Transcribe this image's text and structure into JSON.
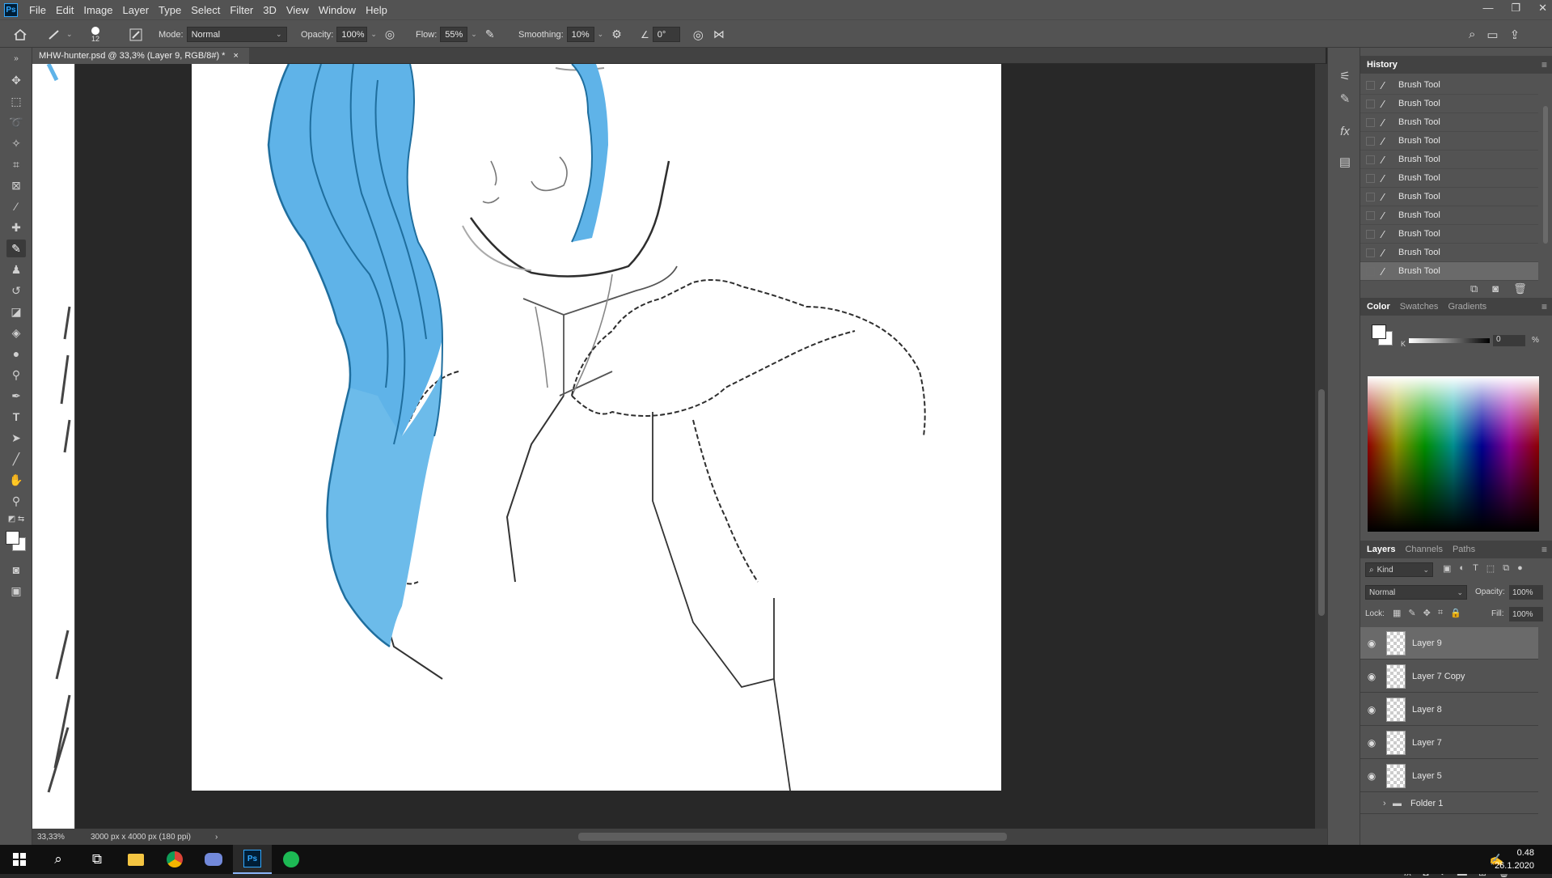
{
  "menubar": {
    "logo": "Ps",
    "items": [
      "File",
      "Edit",
      "Image",
      "Layer",
      "Type",
      "Select",
      "Filter",
      "3D",
      "View",
      "Window",
      "Help"
    ]
  },
  "options": {
    "brush_size": "12",
    "mode_label": "Mode:",
    "mode_value": "Normal",
    "opacity_label": "Opacity:",
    "opacity_value": "100%",
    "flow_label": "Flow:",
    "flow_value": "55%",
    "smoothing_label": "Smoothing:",
    "smoothing_value": "10%",
    "angle_value": "0°"
  },
  "document": {
    "tab_title": "MHW-hunter.psd @ 33,3% (Layer 9, RGB/8#) *",
    "close_glyph": "×"
  },
  "status": {
    "zoom": "33,33%",
    "doc_size": "3000 px x 4000 px (180 ppi)"
  },
  "history": {
    "title": "History",
    "items": [
      "Brush Tool",
      "Brush Tool",
      "Brush Tool",
      "Brush Tool",
      "Brush Tool",
      "Brush Tool",
      "Brush Tool",
      "Brush Tool",
      "Brush Tool",
      "Brush Tool",
      "Brush Tool"
    ]
  },
  "color_panel": {
    "tabs": [
      "Color",
      "Swatches",
      "Gradients"
    ],
    "k_label": "K",
    "k_value": "0",
    "k_unit": "%"
  },
  "layers_panel": {
    "tabs": [
      "Layers",
      "Channels",
      "Paths"
    ],
    "kind_label": "Kind",
    "blend_mode": "Normal",
    "opacity_label": "Opacity:",
    "opacity_value": "100%",
    "lock_label": "Lock:",
    "fill_label": "Fill:",
    "fill_value": "100%",
    "layers": [
      "Layer 9",
      "Layer 7 Copy",
      "Layer 8",
      "Layer 7",
      "Layer 5"
    ],
    "folder": "Folder 1"
  },
  "taskbar": {
    "time": "0.48",
    "date": "26.1.2020"
  },
  "colors": {
    "hair": "#5fb3e8",
    "hair_line": "#1f6e9e",
    "sketch": "#2e2e2e",
    "ps_blue": "#31a8ff"
  }
}
